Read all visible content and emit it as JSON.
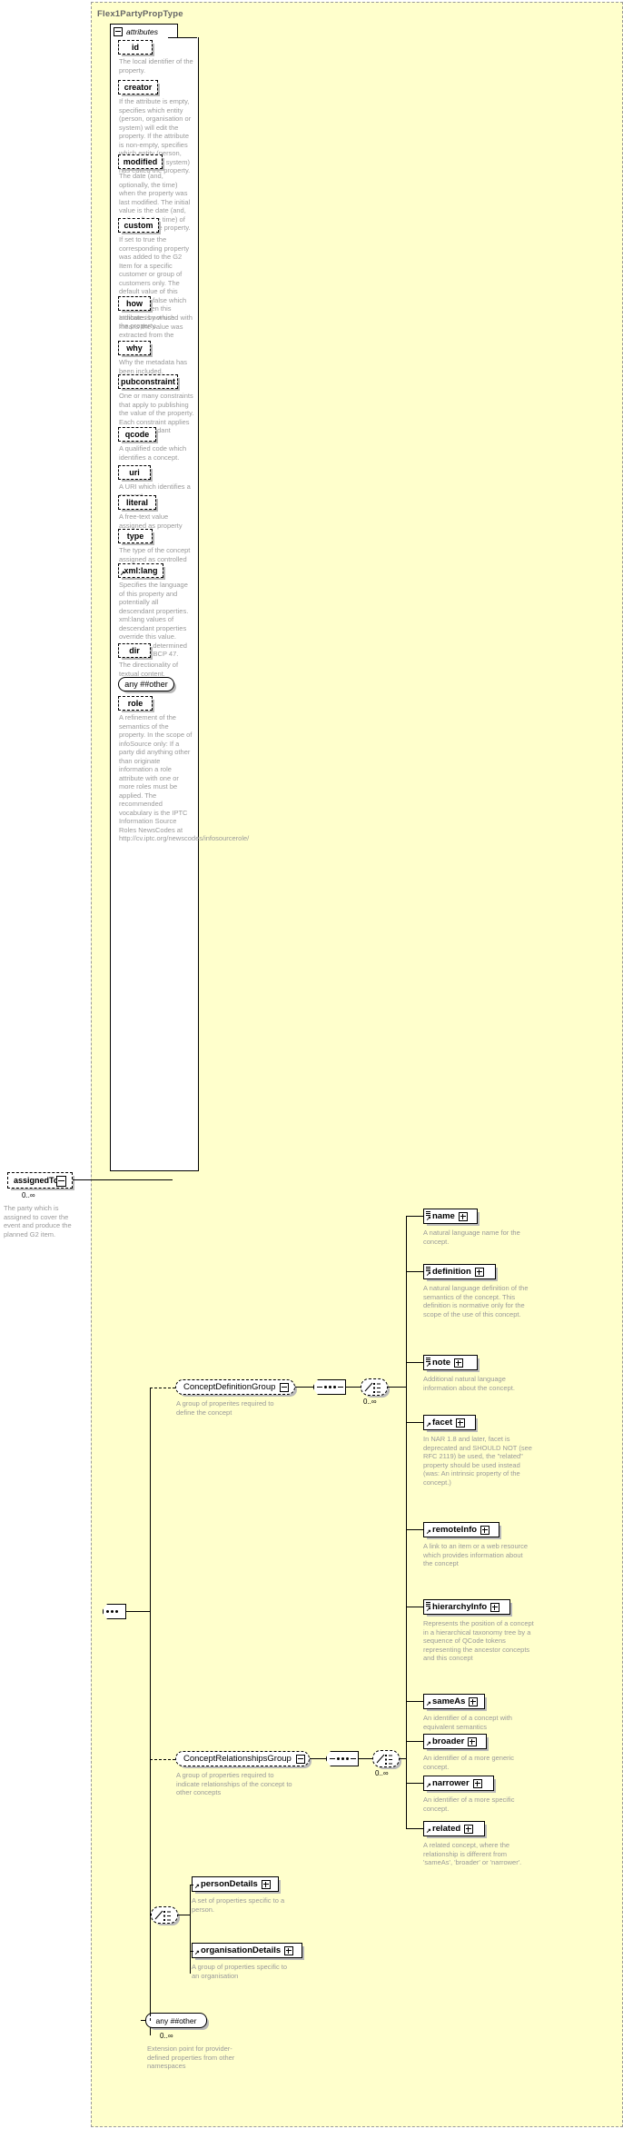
{
  "type_panel": {
    "title": "Flex1PartyPropType"
  },
  "attributes_compartment": {
    "label": "attributes",
    "expander": "minus"
  },
  "attributes": [
    {
      "name": "id",
      "doc": "The local identifier of the property."
    },
    {
      "name": "creator",
      "doc": "If the attribute is empty, specifies which entity (person, organisation or system) will edit the property. If the attribute is non-empty, specifies which entity (person, organisation or system) has edited the property."
    },
    {
      "name": "modified",
      "doc": "The date (and, optionally, the time) when the property was last modified. The initial value is the date (and, optionally, the time) of creation of the property."
    },
    {
      "name": "custom",
      "doc": "If set to true the corresponding property was added to the G2 Item for a specific customer or group of customers only. The default value of this property is false which applies when this attribute is not used with the property."
    },
    {
      "name": "how",
      "doc": "Indicates by which means the value was extracted from the content."
    },
    {
      "name": "why",
      "doc": "Why the metadata has been included."
    },
    {
      "name": "pubconstraint",
      "doc": "One or many constraints that apply to publishing the value of the property. Each constraint applies to all descendant elements."
    },
    {
      "name": "qcode",
      "doc": "A qualified code which identifies a concept."
    },
    {
      "name": "uri",
      "doc": "A URI which identifies a concept."
    },
    {
      "name": "literal",
      "doc": "A free-text value assigned as property value."
    },
    {
      "name": "type",
      "doc": "The type of the concept assigned as controlled property value."
    },
    {
      "name": "xml:lang",
      "doc": "Specifies the language of this property and potentially all descendant properties. xml:lang values of descendant properties override this value. Values are determined by Internet BCP 47."
    },
    {
      "name": "dir",
      "doc": "The directionality of textual content."
    },
    {
      "name": "any ##other",
      "doc": "",
      "kind": "any"
    },
    {
      "name": "role",
      "doc": "A refinement of the semantics of the property. In the scope of infoSource only: If a party did anything other than originate information a role attribute with one or more roles must be applied. The recommended vocabulary is the IPTC Information Source Roles NewsCodes at http://cv.iptc.org/newscodes/infosourcerole/"
    }
  ],
  "root_element": {
    "name": "assignedTo",
    "cardinality": "0..∞",
    "doc": "The party which is assigned to cover the event and produce the planned G2 item."
  },
  "groups": [
    {
      "name": "ConceptDefinitionGroup",
      "doc": "A group of properites required to define the concept",
      "cardinality": "0..∞",
      "elements": [
        {
          "name": "name",
          "doc": "A natural language name for the concept.",
          "icon": "sequence-element"
        },
        {
          "name": "definition",
          "doc": "A natural language definition of the semantics of the concept. This definition is normative only for the scope of the use of this concept.",
          "icon": "sequence-element"
        },
        {
          "name": "note",
          "doc": "Additional natural language information about the concept.",
          "icon": "sequence-element"
        },
        {
          "name": "facet",
          "doc": "In NAR 1.8 and later, facet is deprecated and SHOULD NOT (see RFC 2119) be used, the \"related\" property should be used instead (was: An intrinsic property of the concept.)",
          "icon": "element"
        },
        {
          "name": "remoteInfo",
          "doc": "A link to an item or a web resource which provides information about the concept",
          "icon": "element"
        },
        {
          "name": "hierarchyInfo",
          "doc": "Represents the position of a concept in a hierarchical taxonomy tree by a sequence of QCode tokens representing the ancestor concepts and this concept",
          "icon": "sequence-element"
        }
      ]
    },
    {
      "name": "ConceptRelationshipsGroup",
      "doc": "A group of properties required to indicate relationships of the concept to other concepts",
      "cardinality": "0..∞",
      "elements": [
        {
          "name": "sameAs",
          "doc": "An identifier of a concept with equivalent semantics",
          "icon": "element"
        },
        {
          "name": "broader",
          "doc": "An identifier of a more generic concept.",
          "icon": "element"
        },
        {
          "name": "narrower",
          "doc": "An identifier of a more specific concept.",
          "icon": "element"
        },
        {
          "name": "related",
          "doc": "A related concept, where the relationship is different from 'sameAs', 'broader' or 'narrower'.",
          "icon": "element"
        }
      ]
    }
  ],
  "detail_choice": {
    "elements": [
      {
        "name": "personDetails",
        "doc": "A set of properties specific to a person."
      },
      {
        "name": "organisationDetails",
        "doc": "A group of properties specific to an organisation"
      }
    ]
  },
  "extension_point": {
    "name": "any ##other",
    "cardinality": "0..∞",
    "doc": "Extension point for provider-defined properties from other namespaces"
  },
  "colors": {
    "panel_background": "#ffffcc",
    "panel_border": "#999999",
    "node_background": "#ffffff",
    "node_border": "#000000",
    "doc_text": "#9a9a9a",
    "title_text": "#666666",
    "shadow": "#b9b9b9"
  }
}
